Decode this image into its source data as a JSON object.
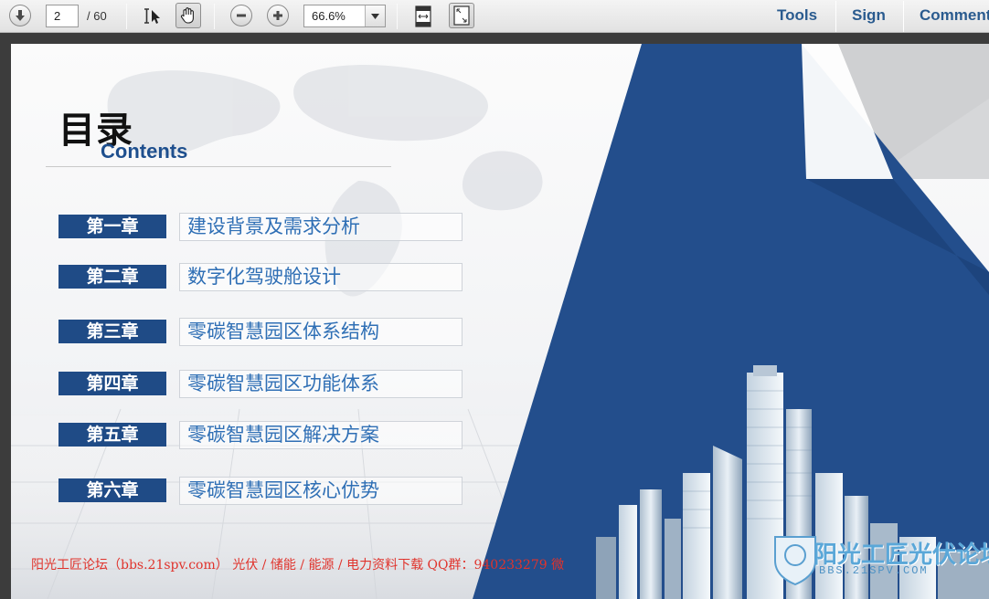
{
  "toolbar": {
    "page_current": "2",
    "page_total": "/ 60",
    "zoom": "66.6%",
    "menu": {
      "tools": "Tools",
      "sign": "Sign",
      "comment": "Comment"
    },
    "icons": [
      "arrow-down-icon",
      "select-text-icon",
      "hand-icon",
      "zoom-out-icon",
      "zoom-in-icon",
      "fit-page-icon",
      "fullscreen-icon"
    ]
  },
  "document": {
    "title_cn": "目录",
    "title_en": "Contents",
    "chapters": [
      {
        "tag": "第一章",
        "title": "建设背景及需求分析"
      },
      {
        "tag": "第二章",
        "title": "数字化驾驶舱设计"
      },
      {
        "tag": "第三章",
        "title": "零碳智慧园区体系结构"
      },
      {
        "tag": "第四章",
        "title": "零碳智慧园区功能体系"
      },
      {
        "tag": "第五章",
        "title": "零碳智慧园区解决方案"
      },
      {
        "tag": "第六章",
        "title": "零碳智慧园区核心优势"
      }
    ],
    "footer": "阳光工匠论坛（bbs.21spv.com）   光伏 / 储能 / 能源 / 电力资料下载   QQ群：940233279   微",
    "logo_text": "阳光工匠光伏论坛",
    "logo_sub": "BBS.21SPV.COM"
  },
  "colors": {
    "accent_blue": "#1f4b86",
    "chapter_text": "#2f6fb5",
    "footer_red": "#e0332c",
    "menu_blue": "#2a5b8f"
  }
}
